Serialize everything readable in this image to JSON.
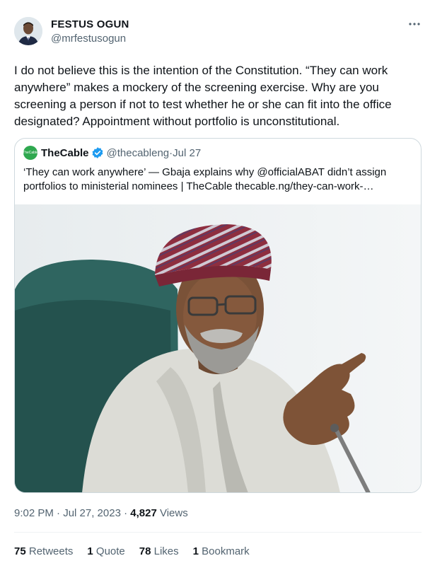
{
  "author": {
    "name": "FESTUS OGUN",
    "handle": "@mrfestusogun"
  },
  "tweet": {
    "text": "I do not believe this is the intention of the Constitution. “They can work anywhere” makes a mockery of the screening exercise. Why are you screening a person if not to test whether he or she can fit into the office designated? Appointment without portfolio is unconstitutional.",
    "time": "9:02 PM · Jul 27, 2023 · ",
    "views_count": "4,827",
    "views_label": " Views"
  },
  "quote": {
    "avatar_text": "TheCable",
    "name": "TheCable",
    "handle": "@thecableng",
    "separator": " · ",
    "date": "Jul 27",
    "text_line1": "‘They can work anywhere’ — Gbaja explains why @officialABAT didn’t assign",
    "text_line2": "portfolios to ministerial nominees | TheCable thecable.ng/they-can-work-…"
  },
  "stats": {
    "retweets_count": "75",
    "retweets_label": " Retweets",
    "quotes_count": "1",
    "quotes_label": " Quote",
    "likes_count": "78",
    "likes_label": " Likes",
    "bookmarks_count": "1",
    "bookmarks_label": " Bookmark"
  },
  "colors": {
    "verified": "#1d9bf0",
    "cable_green": "#2fa84f",
    "secondary_text": "#536471"
  },
  "icons": [
    "more-icon",
    "verified-badge-icon"
  ]
}
